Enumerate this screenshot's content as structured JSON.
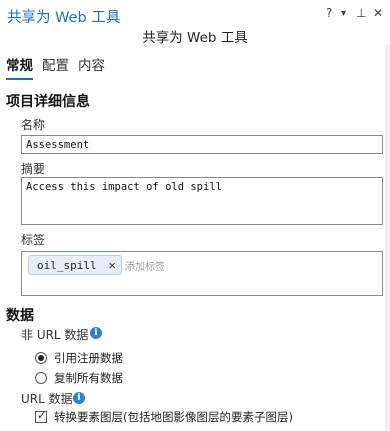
{
  "window": {
    "title": "共享为 Web 工具",
    "controls": {
      "help": "?",
      "menu": "▾",
      "pin": "⊥",
      "close": "✕"
    }
  },
  "pane": {
    "subtitle": "共享为 Web 工具",
    "tabs": [
      {
        "label": "常规",
        "active": true
      },
      {
        "label": "配置",
        "active": false
      },
      {
        "label": "内容",
        "active": false
      }
    ]
  },
  "item_details": {
    "heading": "项目详细信息",
    "name_label": "名称",
    "name_value": "Assessment",
    "summary_label": "摘要",
    "summary_value": "Access this impact of old spill",
    "tags_label": "标签",
    "tags": [
      "oil_spill"
    ],
    "tags_placeholder": "添加标签"
  },
  "data_section": {
    "heading": "数据",
    "non_url_label": "非 URL 数据",
    "radio_options": [
      {
        "label": "引用注册数据",
        "selected": true
      },
      {
        "label": "复制所有数据",
        "selected": false
      }
    ],
    "url_label": "URL 数据",
    "checkbox_label": "转换要素图层(包括地图影像图层的要素子图层)",
    "checkbox_checked": true
  },
  "colors": {
    "accent": "#1e6fb8",
    "info": "#2f7fd0"
  }
}
